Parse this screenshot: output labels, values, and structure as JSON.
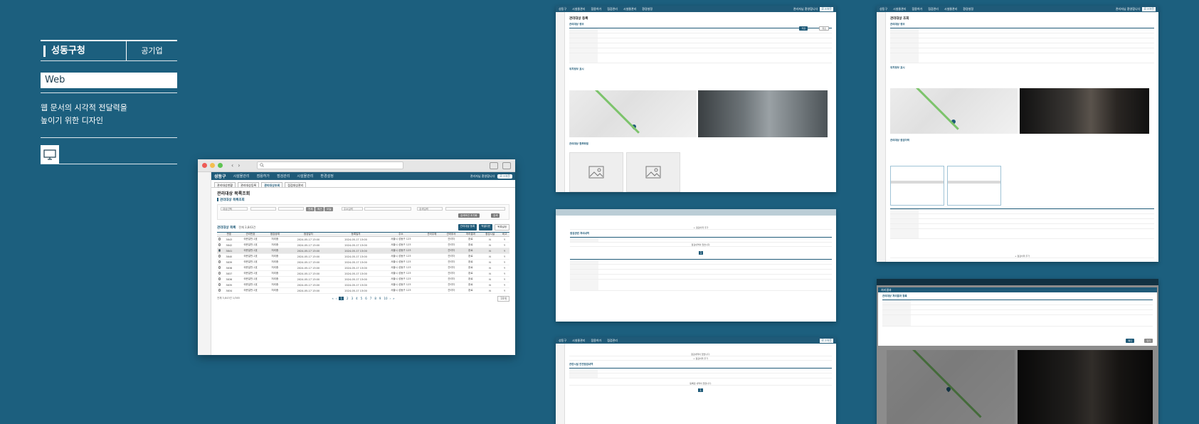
{
  "info": {
    "organization": "성동구청",
    "org_type": "공기업",
    "platform": "Web",
    "description_line1": "웹 문서의 시각적 전달력을",
    "description_line2": "높이기 위한 디자인",
    "device_icon": "monitor-icon"
  },
  "browser": {
    "nav_back": "‹",
    "nav_forward": "›",
    "app": {
      "logo": "성동구",
      "menus": [
        "시설물관리",
        "점용허가",
        "점검관리",
        "시설물관리",
        "환경설정"
      ],
      "user_text": "관리자님 환영합니다",
      "logout": "로그아웃",
      "subtabs": [
        "관리대상현황",
        "관리대상등록",
        "관리대상조회",
        "점검대상관리"
      ],
      "page_title": "관리대상 목록조회",
      "filter_section": "관리대상 목록조회",
      "filter_fields": [
        "대상선택",
        "",
        "",
        "주소입력",
        "검색입력"
      ],
      "filter_chips": [
        "전체",
        "최근",
        "오늘"
      ],
      "filter_buttons": {
        "reset": "검색조건 초기화",
        "search": "검색"
      },
      "list_title": "관리대상 목록",
      "list_count": "전체 3,843건",
      "list_actions": [
        "관리대상 등록",
        "엑셀다운",
        "목록설정"
      ],
      "columns": [
        "",
        "번호",
        "관리번호",
        "점검상태",
        "점검일자",
        "등록일자",
        "주소",
        "관리주체",
        "관리부서",
        "처리결과",
        "점검시설",
        "비고"
      ],
      "rows": [
        [
          "",
          "3843",
          "국문일반-1호",
          "처리중",
          "2024-05-17 13:00",
          "2024-05-17 13:00",
          "서울시 성동구 123",
          "",
          "관리자",
          "완료",
          "N",
          "Y"
        ],
        [
          "",
          "3842",
          "국문일반-1호",
          "처리중",
          "2024-05-17 13:00",
          "2024-05-17 13:00",
          "서울시 성동구 123",
          "",
          "관리자",
          "완료",
          "N",
          "Y"
        ],
        [
          "",
          "3841",
          "국문일반-1호",
          "처리중",
          "2024-05-17 13:00",
          "2024-05-17 13:00",
          "서울시 성동구 123",
          "",
          "관리자",
          "완료",
          "N",
          "Y"
        ],
        [
          "",
          "3840",
          "국문일반-1호",
          "처리중",
          "2024-05-17 13:00",
          "2024-05-17 13:00",
          "서울시 성동구 123",
          "",
          "관리자",
          "완료",
          "N",
          "Y"
        ],
        [
          "",
          "3839",
          "국문일반-1호",
          "처리중",
          "2024-05-17 13:00",
          "2024-05-17 13:00",
          "서울시 성동구 123",
          "",
          "관리자",
          "완료",
          "N",
          "Y"
        ],
        [
          "",
          "3838",
          "국문일반-1호",
          "처리중",
          "2024-05-17 13:00",
          "2024-05-17 13:00",
          "서울시 성동구 123",
          "",
          "관리자",
          "완료",
          "N",
          "Y"
        ],
        [
          "",
          "3837",
          "국문일반-1호",
          "처리중",
          "2024-05-17 13:00",
          "2024-05-17 13:00",
          "서울시 성동구 123",
          "",
          "관리자",
          "완료",
          "N",
          "Y"
        ],
        [
          "",
          "3836",
          "국문일반-1호",
          "처리중",
          "2024-05-17 13:00",
          "2024-05-17 13:00",
          "서울시 성동구 123",
          "",
          "관리자",
          "완료",
          "N",
          "Y"
        ],
        [
          "",
          "3835",
          "국문일반-1호",
          "처리중",
          "2024-05-17 13:00",
          "2024-05-17 13:00",
          "서울시 성동구 123",
          "",
          "관리자",
          "완료",
          "N",
          "Y"
        ],
        [
          "",
          "3834",
          "국문일반-1호",
          "처리중",
          "2024-05-17 13:00",
          "2024-05-17 13:00",
          "서울시 성동구 123",
          "",
          "관리자",
          "완료",
          "N",
          "Y"
        ]
      ],
      "selected_row": 2,
      "pager": {
        "total": "전체 3,843건 1/385",
        "pages": [
          "1",
          "2",
          "3",
          "4",
          "5",
          "6",
          "7",
          "8",
          "9",
          "10"
        ],
        "current": "1",
        "size": "10개"
      }
    }
  },
  "tiles": {
    "register": {
      "title": "관리대상 등록",
      "section1": "관리대상 정보",
      "section2": "위치정보 표시",
      "section3": "로드뷰",
      "section4": "관리대상 첨부파일",
      "save": "저장",
      "cancel": "취소"
    },
    "detail": {
      "title": "관리대상 조회",
      "section1": "관리대상 정보",
      "section2": "위치정보 표시",
      "section3": "로드뷰",
      "section4": "관리대상 점검이력"
    },
    "history": {
      "section": "점검관련 처리내역",
      "empty": "점검내역이 없습니다.",
      "more": "+ 점검이력 추가"
    },
    "facility": {
      "section": "관련시설 안전점검내역",
      "empty": "등록된 내역이 없습니다."
    },
    "modal": {
      "title": "처리결과",
      "section": "관리대상 처리결과 등록",
      "confirm": "확인",
      "close": "닫기"
    }
  },
  "colors": {
    "background": "#1c5f7e",
    "brand": "#1f5a78",
    "accent_green": "#7cc36b"
  }
}
